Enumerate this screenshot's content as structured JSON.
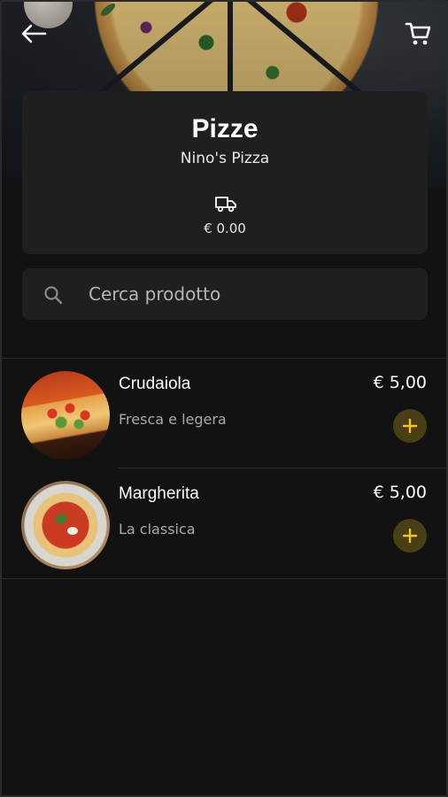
{
  "header": {
    "back_icon": "arrow-left-icon",
    "cart_icon": "shopping-cart-icon"
  },
  "category": {
    "title": "Pizze",
    "restaurant": "Nino's Pizza",
    "delivery_icon": "truck-icon",
    "delivery_fee": "€ 0.00"
  },
  "search": {
    "icon": "search-icon",
    "placeholder": "Cerca prodotto"
  },
  "products": [
    {
      "name": "Crudaiola",
      "description": "Fresca e legera",
      "price": "€ 5,00",
      "add_icon": "plus-icon"
    },
    {
      "name": "Margherita",
      "description": "La classica",
      "price": "€ 5,00",
      "add_icon": "plus-icon"
    }
  ],
  "colors": {
    "background": "#121212",
    "card": "#1f1f1f",
    "accent": "#f2c230",
    "add_button_bg": "#4a3f14"
  }
}
